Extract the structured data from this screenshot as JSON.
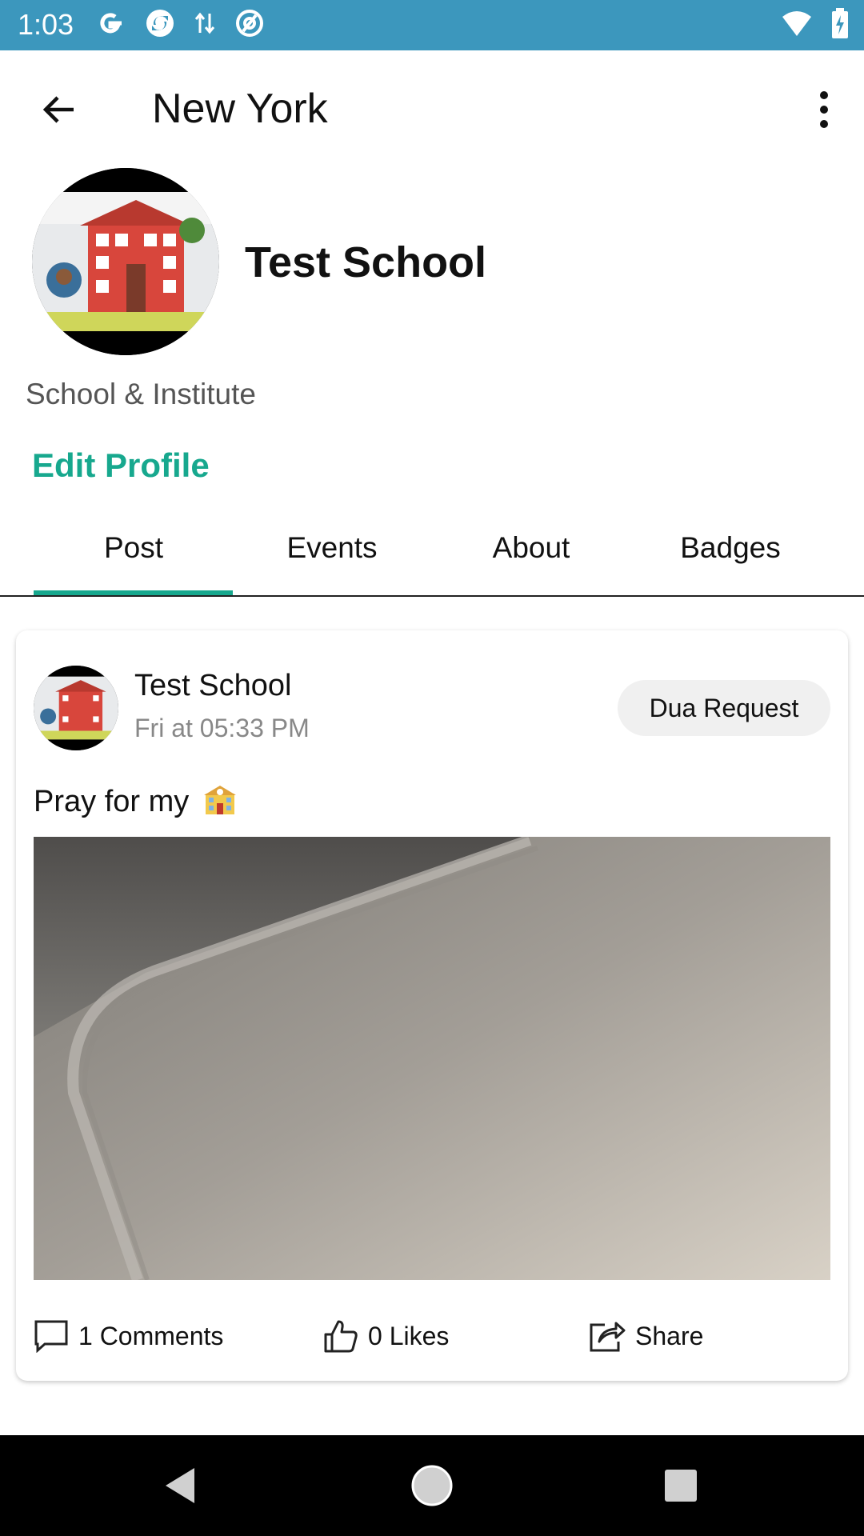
{
  "status_bar": {
    "time": "1:03",
    "left_icons": [
      "google-icon",
      "browser-sync-icon",
      "data-transfer-icon",
      "at-sign-icon"
    ],
    "right_icons": [
      "wifi-icon",
      "battery-charging-icon"
    ],
    "background": "#3c97bd"
  },
  "app_bar": {
    "title": "New York",
    "back_icon": "arrow-left-icon",
    "menu_icon": "more-vertical-icon"
  },
  "profile": {
    "name": "Test School",
    "category": "School & Institute",
    "edit_label": "Edit Profile",
    "accent_color": "#17a88e"
  },
  "tabs": [
    {
      "label": "Post",
      "selected": true
    },
    {
      "label": "Events",
      "selected": false
    },
    {
      "label": "About",
      "selected": false
    },
    {
      "label": "Badges",
      "selected": false
    }
  ],
  "post": {
    "author": "Test School",
    "time": "Fri at 05:33 PM",
    "request_label": "Dua Request",
    "text": "Pray for my",
    "emoji": "🏫",
    "actions": {
      "comments": "1 Comments",
      "likes": "0 Likes",
      "share": "Share"
    }
  },
  "nav_bar": {
    "buttons": [
      "back-triangle-icon",
      "home-circle-icon",
      "recents-square-icon"
    ]
  }
}
